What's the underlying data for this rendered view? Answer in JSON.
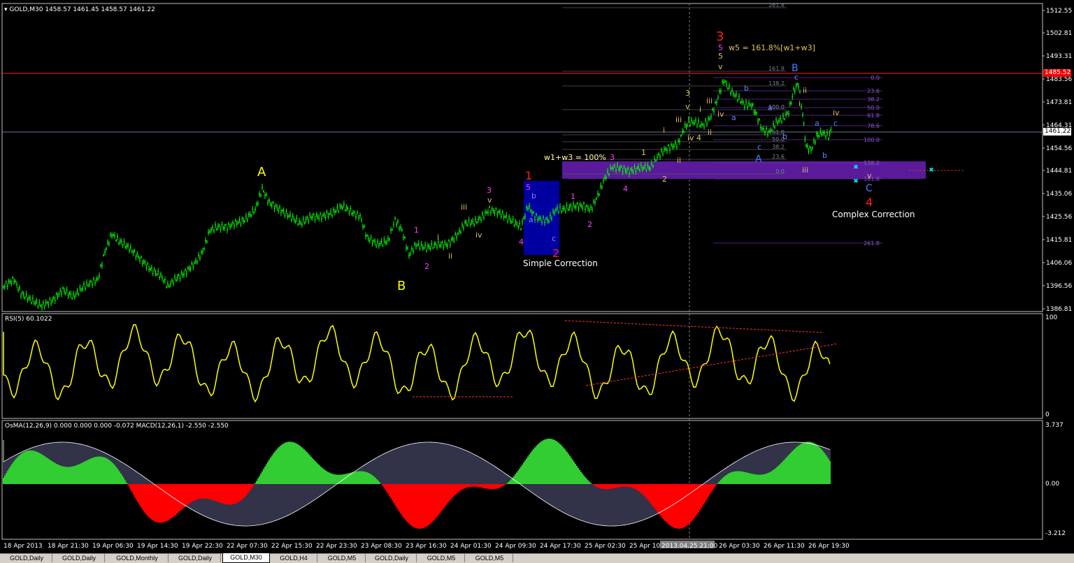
{
  "main_panel": {
    "header": "GOLD,M30  1458.57 1461.45 1458.57 1461.22",
    "price_axis": [
      "1512.55",
      "1502.81",
      "1493.31",
      "1483.56",
      "1473.81",
      "1464.31",
      "1454.56",
      "1444.81",
      "1435.06",
      "1425.56",
      "1415.81",
      "1406.06",
      "1396.56",
      "1386.81"
    ],
    "red_line_price": "1485.52",
    "current_price": "1461.22",
    "wave_labels": {
      "A_major": "A",
      "B_major": "B",
      "w1": "1",
      "w2": "2",
      "w3": "3",
      "w4": "4",
      "w5": "5",
      "w1w3": "w1+w3 = 100%",
      "w5ratio": "w5 = 161.8%[w1+w3]",
      "simple_correction": "Simple Correction",
      "complex_correction": "Complex Correction",
      "roman": [
        "i",
        "ii",
        "iii",
        "iv",
        "v"
      ],
      "abc": [
        "a",
        "b",
        "c"
      ],
      "A_cap": "A",
      "B_cap": "B",
      "C_cap": "C"
    },
    "fib_labels_left": [
      "261.8",
      "161.8",
      "138.2",
      "100.0",
      "61.8",
      "50.0",
      "38.2",
      "23.6",
      "0.0"
    ],
    "fib_labels_right": [
      "0.0",
      "23.6",
      "38.2",
      "50.0",
      "61.8",
      "78.6",
      "100.0",
      "138.2",
      "161.8",
      "261.8"
    ]
  },
  "rsi_panel": {
    "header": "RSI(5) 60.1022",
    "axis_top": "100",
    "axis_bottom": "0"
  },
  "osma_panel": {
    "header": "OsMA(12,26,9) 0.000 0.000 0.000 -0.072  MACD(12,26,1) -2.550 -2.550",
    "axis_top": "3.737",
    "axis_mid": "0.00",
    "axis_bottom": "-3.212"
  },
  "time_axis": [
    "18 Apr 2013",
    "18 Apr 21:30",
    "19 Apr 06:30",
    "19 Apr 14:30",
    "19 Apr 22:30",
    "22 Apr 07:30",
    "22 Apr 15:30",
    "22 Apr 23:30",
    "23 Apr 08:30",
    "23 Apr 16:30",
    "24 Apr 01:30",
    "24 Apr 09:30",
    "24 Apr 17:30",
    "25 Apr 02:30",
    "25 Apr 10:",
    "2013.04.25 21:00",
    "26 Apr 03:30",
    "26 Apr 11:30",
    "26 Apr 19:30"
  ],
  "tabs": [
    "GOLD,Daily",
    "GOLD,Daily",
    "GOLD,Monthly",
    "GOLD,Daily",
    "GOLD,M30",
    "GOLD,H4",
    "GOLD,M5",
    "GOLD,Daily",
    "GOLD,M5",
    "GOLD,M5"
  ],
  "active_tab": 4,
  "colors": {
    "candles": "#00ff00",
    "rsi": "#ffff00",
    "osma_pos": "#32cd32",
    "osma_neg": "#ff0000",
    "macd_line": "#c0c0ff",
    "zone": "#5a1a9a",
    "simple_box": "#0000a0"
  }
}
